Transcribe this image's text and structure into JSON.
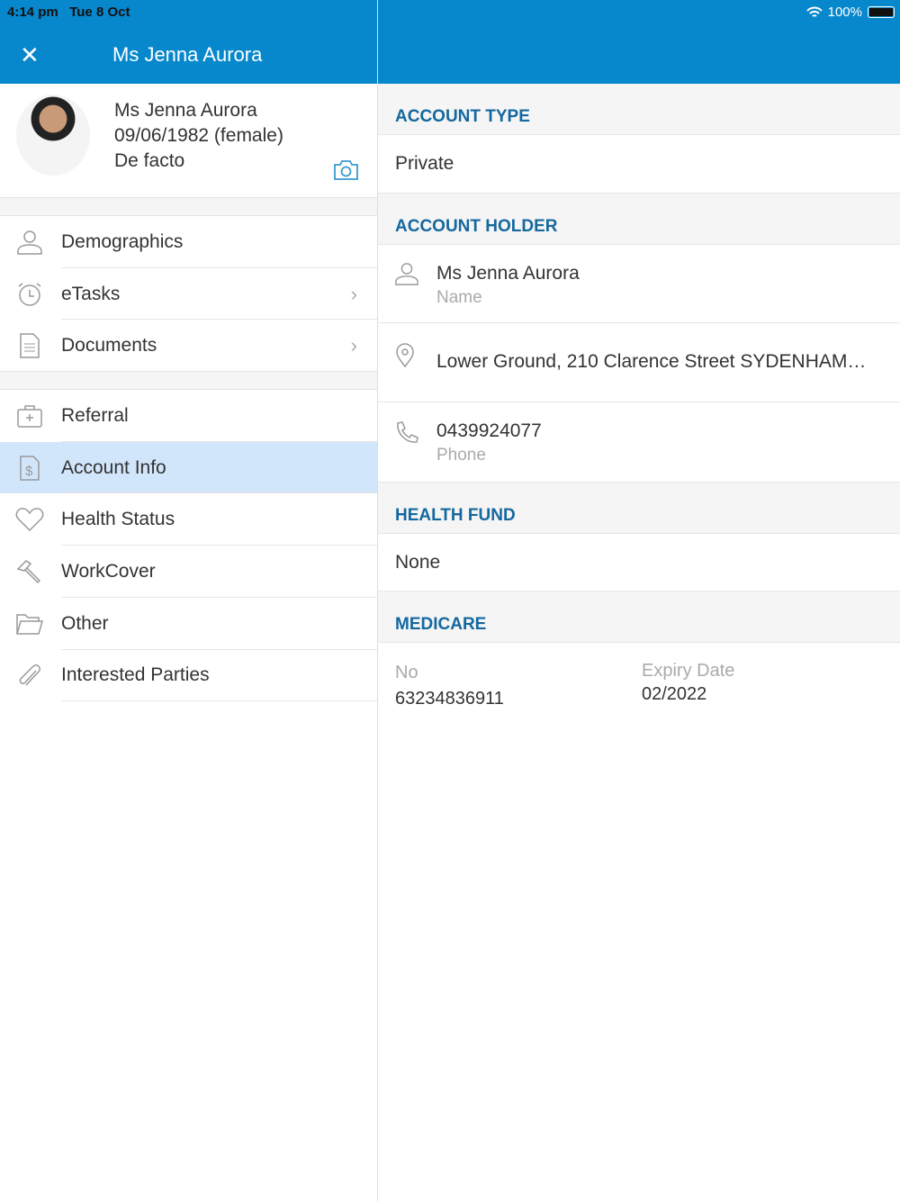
{
  "status": {
    "time": "4:14 pm",
    "date": "Tue 8 Oct",
    "battery": "100%",
    "battery_level": 1.0
  },
  "nav": {
    "title": "Ms Jenna Aurora"
  },
  "profile": {
    "name": "Ms Jenna Aurora",
    "dob": "09/06/1982 (female)",
    "status": "De facto"
  },
  "menu": {
    "group1": [
      {
        "label": "Demographics"
      },
      {
        "label": "eTasks"
      },
      {
        "label": "Documents"
      }
    ],
    "group2": [
      {
        "label": "Referral"
      },
      {
        "label": "Account Info"
      },
      {
        "label": "Health Status"
      },
      {
        "label": "WorkCover"
      },
      {
        "label": "Other"
      },
      {
        "label": "Interested Parties"
      }
    ]
  },
  "detail": {
    "account_type": {
      "header": "ACCOUNT TYPE",
      "value": "Private"
    },
    "account_holder": {
      "header": "ACCOUNT HOLDER",
      "name": "Ms Jenna Aurora",
      "name_label": "Name",
      "address": "Lower Ground, 210 Clarence Street SYDENHAM…",
      "phone": "0439924077",
      "phone_label": "Phone"
    },
    "health_fund": {
      "header": "HEALTH FUND",
      "value": "None"
    },
    "medicare": {
      "header": "MEDICARE",
      "no_label": "No",
      "no": "63234836911",
      "expiry_label": "Expiry Date",
      "expiry": "02/2022"
    }
  }
}
